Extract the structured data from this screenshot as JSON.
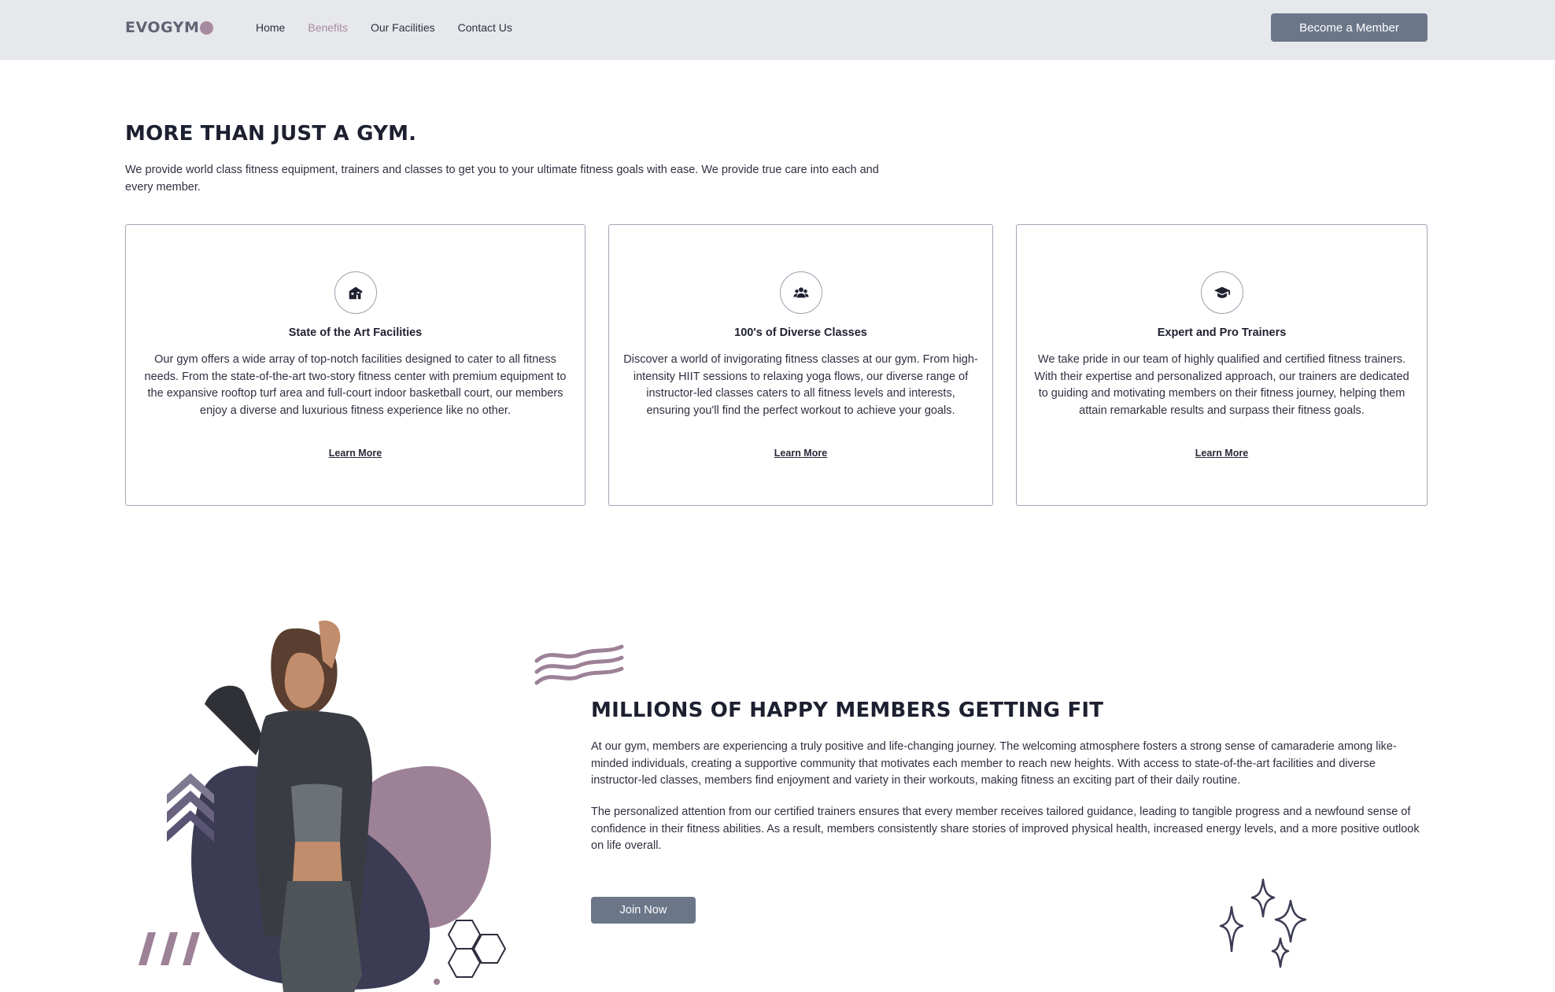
{
  "navbar": {
    "logo_text": "EVOGYM",
    "links": [
      "Home",
      "Benefits",
      "Our Facilities",
      "Contact Us"
    ],
    "active_link": "Benefits",
    "cta_label": "Become a Member"
  },
  "benefits": {
    "title": "MORE THAN JUST A GYM.",
    "description": "We provide world class fitness equipment, trainers and classes to get you to your ultimate fitness goals with ease. We provide true care into each and every member.",
    "cards": [
      {
        "icon": "home-modern-icon",
        "title": "State of the Art Facilities",
        "text": "Our gym offers a wide array of top-notch facilities designed to cater to all fitness needs. From the state-of-the-art two-story fitness center with premium equipment to the expansive rooftop turf area and full-court indoor basketball court, our members enjoy a diverse and luxurious fitness experience like no other.",
        "link": "Learn More"
      },
      {
        "icon": "user-group-icon",
        "title": "100's of Diverse Classes",
        "text": "Discover a world of invigorating fitness classes at our gym. From high-intensity HIIT sessions to relaxing yoga flows, our diverse range of instructor-led classes caters to all fitness levels and interests, ensuring you'll find the perfect workout to achieve your goals.",
        "link": "Learn More"
      },
      {
        "icon": "academic-cap-icon",
        "title": "Expert and Pro Trainers",
        "text": "We take pride in our team of highly qualified and certified fitness trainers. With their expertise and personalized approach, our trainers are dedicated to guiding and motivating members on their fitness journey, helping them attain remarkable results and surpass their fitness goals.",
        "link": "Learn More"
      }
    ]
  },
  "happy_members": {
    "title": "MILLIONS OF HAPPY MEMBERS GETTING FIT",
    "paragraph_1": "At our gym, members are experiencing a truly positive and life-changing journey. The welcoming atmosphere fosters a strong sense of camaraderie among like-minded individuals, creating a supportive community that motivates each member to reach new heights. With access to state-of-the-art facilities and diverse instructor-led classes, members find enjoyment and variety in their workouts, making fitness an exciting part of their daily routine.",
    "paragraph_2": "The personalized attention from our certified trainers ensures that every member receives tailored guidance, leading to tangible progress and a newfound sense of confidence in their fitness abilities. As a result, members consistently share stories of improved physical health, increased energy levels, and a more positive outlook on life overall.",
    "cta_label": "Join Now"
  },
  "colors": {
    "navbar_bg": "#e7e8ec",
    "primary_button": "#6b7689",
    "accent": "#a68a9e",
    "dark_shape": "#3b3c54",
    "card_border": "#a8a4b6"
  }
}
